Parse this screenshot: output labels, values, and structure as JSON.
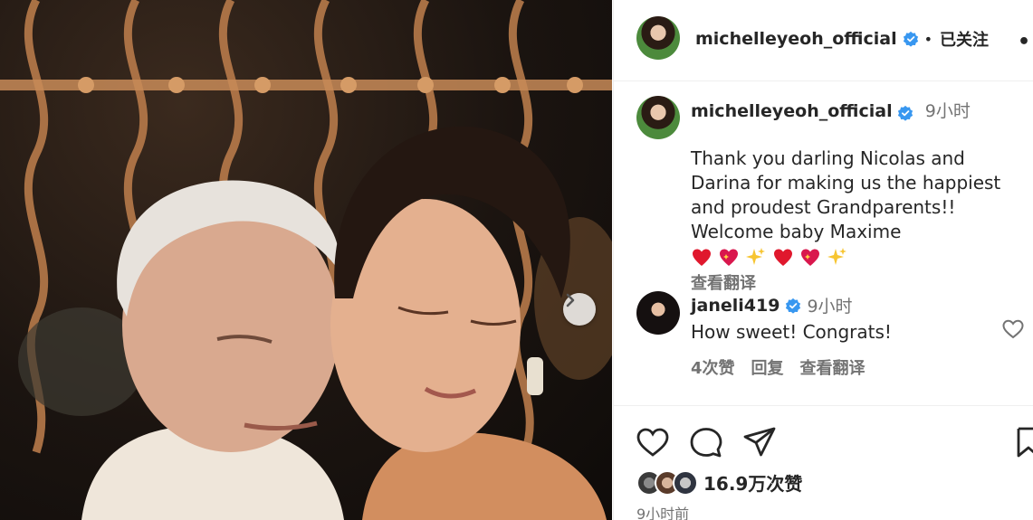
{
  "post": {
    "username": "michelleyeoh_official",
    "follow_status": "已关注",
    "separator": "•",
    "more_label": "••",
    "caption": {
      "time": "9小时",
      "text": "Thank you darling Nicolas and\nDarina for making us the happiest\nand proudest Grandparents!!\nWelcome baby Maxime",
      "emojis": [
        "red-heart",
        "sparkling-heart",
        "sparkles",
        "red-heart",
        "sparkling-heart",
        "sparkles"
      ],
      "translate_label": "查看翻译"
    },
    "comment": {
      "username": "janeli419",
      "time": "9小时",
      "text": "How sweet! Congrats!",
      "likes_label": "4次赞",
      "reply_label": "回复",
      "translate_label": "查看翻译"
    },
    "likes_count": "16.9万次赞",
    "time_ago": "9小时前"
  },
  "colors": {
    "verified_blue": "#3897f0",
    "text_primary": "#262626",
    "text_secondary": "#737373",
    "heart_red": "#e0182d"
  },
  "icons": [
    "verified-badge-icon",
    "more-options-icon",
    "next-image-icon",
    "like-icon",
    "comment-icon",
    "share-icon",
    "bookmark-icon",
    "comment-like-icon"
  ]
}
